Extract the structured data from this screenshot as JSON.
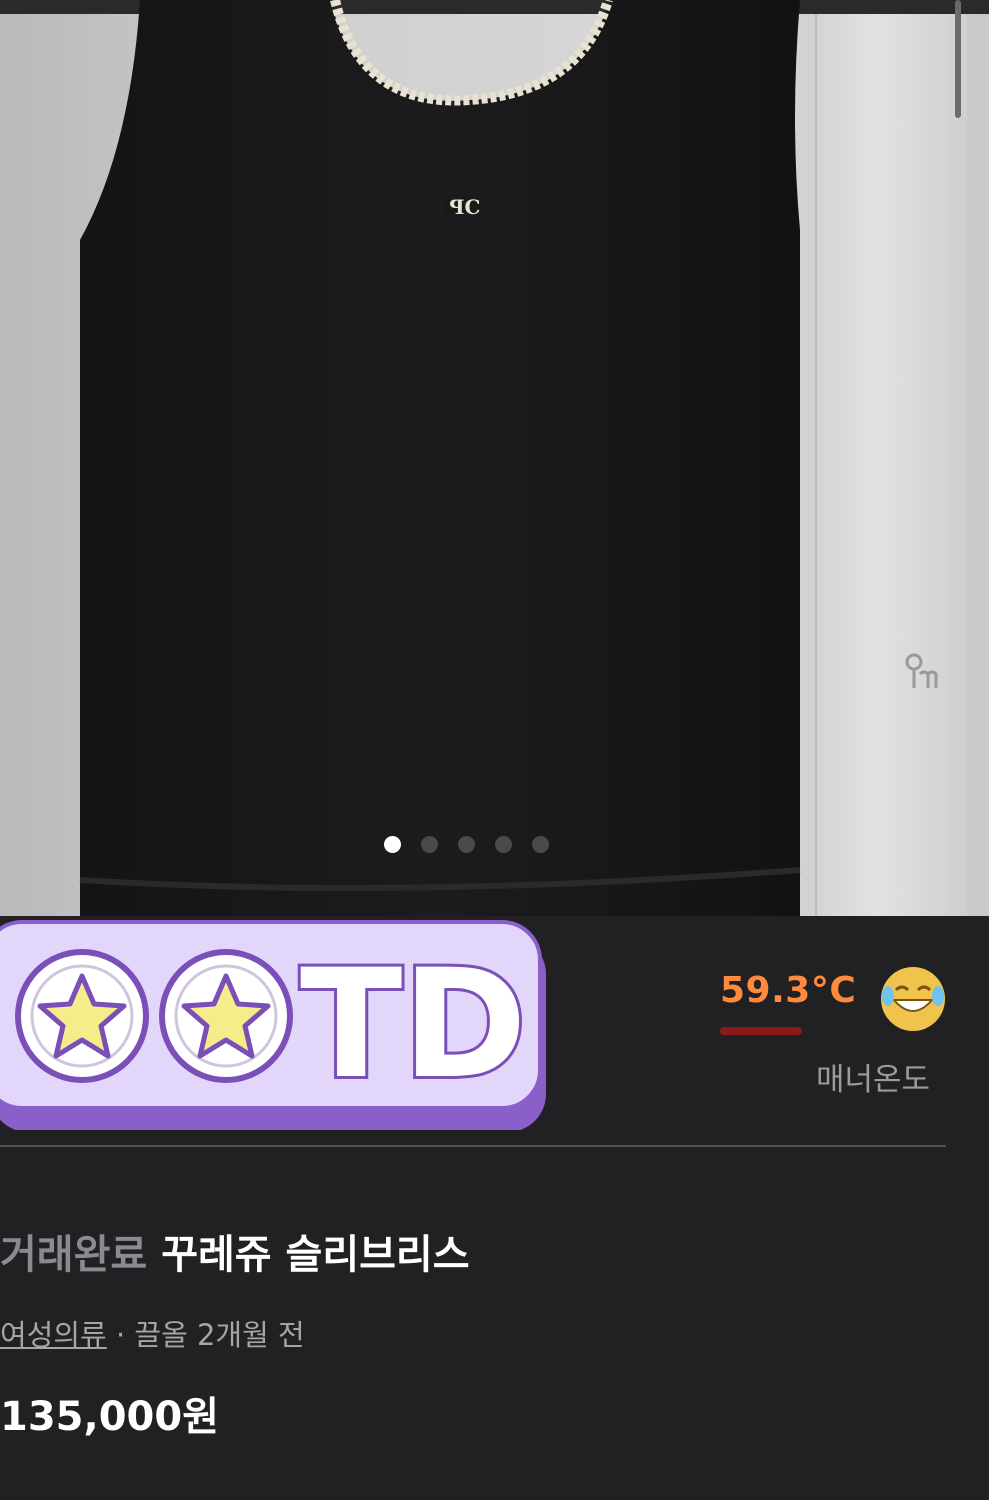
{
  "listing": {
    "image_pagination": {
      "total": 5,
      "current": 1
    },
    "sticker_text": "TD",
    "temperature": {
      "value": "59.3°C",
      "label": "매너온도",
      "color": "#ff8a3d"
    },
    "title": {
      "status": "거래완료",
      "name": "꾸레쥬 슬리브리스"
    },
    "meta": {
      "category": "여성의류",
      "separator": " · ",
      "location_time": "끌올 2개월 전"
    },
    "price": "135,000원"
  },
  "colors": {
    "background": "#212124",
    "accent": "#ff8a3d",
    "sticker_fill": "#e3d6fb",
    "sticker_border": "#8a5fc9",
    "star": "#f5ec8a"
  }
}
